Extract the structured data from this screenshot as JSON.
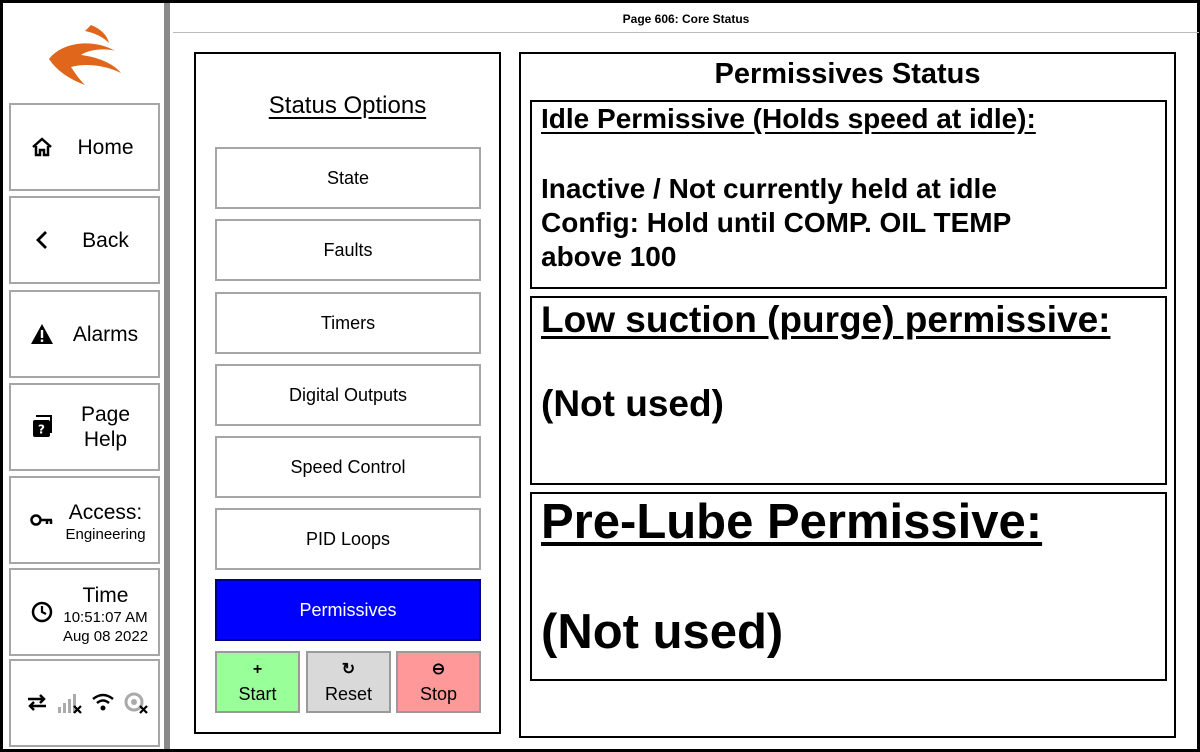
{
  "header": {
    "title": "Page 606: Core Status"
  },
  "sidebar": {
    "home_label": "Home",
    "back_label": "Back",
    "alarms_label": "Alarms",
    "page_help_label": "Page Help",
    "access_label": "Access:",
    "access_level": "Engineering",
    "time_label": "Time",
    "time_value": "10:51:07 AM",
    "date_value": "Aug 08 2022"
  },
  "status_options": {
    "title": "Status Options",
    "items": [
      {
        "label": "State",
        "active": false
      },
      {
        "label": "Faults",
        "active": false
      },
      {
        "label": "Timers",
        "active": false
      },
      {
        "label": "Digital Outputs",
        "active": false
      },
      {
        "label": "Speed Control",
        "active": false
      },
      {
        "label": "PID Loops",
        "active": false
      },
      {
        "label": "Permissives",
        "active": true
      }
    ],
    "controls": {
      "start_glyph": "+",
      "start_label": "Start",
      "reset_glyph": "↻",
      "reset_label": "Reset",
      "stop_glyph": "⊖",
      "stop_label": "Stop"
    }
  },
  "permissives": {
    "title": "Permissives Status",
    "idle": {
      "heading": "Idle Permissive (Holds speed at idle):",
      "line1": "Inactive / Not currently held at idle",
      "line2": "Config: Hold until COMP. OIL TEMP",
      "line3": "above 100"
    },
    "low_suction": {
      "heading": "Low suction (purge) permissive:",
      "value": "(Not used)"
    },
    "pre_lube": {
      "heading": "Pre-Lube Permissive:",
      "value": "(Not used)"
    }
  },
  "colors": {
    "active_button": "#0000ff",
    "start_button": "#99ff99",
    "reset_button": "#d9d9d9",
    "stop_button": "#ff9999",
    "logo": "#e0661c"
  },
  "icons": [
    "home-icon",
    "chevron-left-icon",
    "warning-icon",
    "help-book-icon",
    "key-icon",
    "clock-icon",
    "transfer-icon",
    "signal-icon",
    "wifi-icon",
    "gps-icon"
  ]
}
